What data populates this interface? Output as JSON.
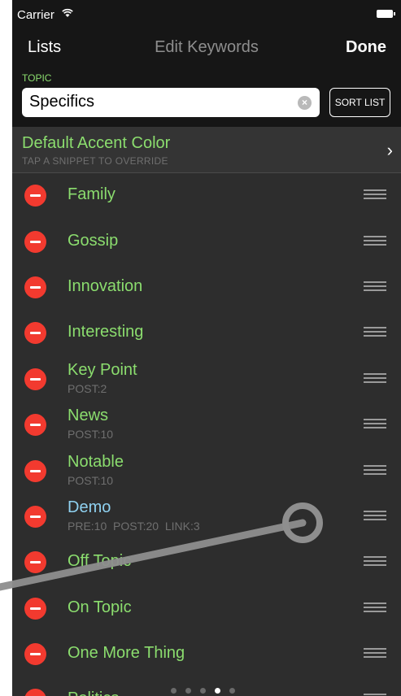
{
  "status": {
    "carrier": "Carrier"
  },
  "nav": {
    "left": "Lists",
    "title": "Edit Keywords",
    "right": "Done"
  },
  "topic": {
    "label": "TOPIC",
    "value": "Specifics",
    "sort_button": "SORT LIST"
  },
  "accent": {
    "title": "Default Accent Color",
    "subtitle": "TAP A SNIPPET TO OVERRIDE"
  },
  "items": [
    {
      "label": "Family",
      "sub": ""
    },
    {
      "label": "Gossip",
      "sub": ""
    },
    {
      "label": "Innovation",
      "sub": ""
    },
    {
      "label": "Interesting",
      "sub": ""
    },
    {
      "label": "Key Point",
      "sub": "POST:2"
    },
    {
      "label": "News",
      "sub": "POST:10"
    },
    {
      "label": "Notable",
      "sub": "POST:10"
    },
    {
      "label": "Demo",
      "sub": "PRE:10  POST:20  LINK:3"
    },
    {
      "label": "Off Topic",
      "sub": ""
    },
    {
      "label": "On Topic",
      "sub": ""
    },
    {
      "label": "One More Thing",
      "sub": ""
    },
    {
      "label": "Politics",
      "sub": ""
    }
  ],
  "pager": {
    "count": 5,
    "active_index": 3
  },
  "colors": {
    "accent_green": "#8bdd6e",
    "accent_blue": "#8fd1f0",
    "delete_red": "#f23a2f"
  }
}
